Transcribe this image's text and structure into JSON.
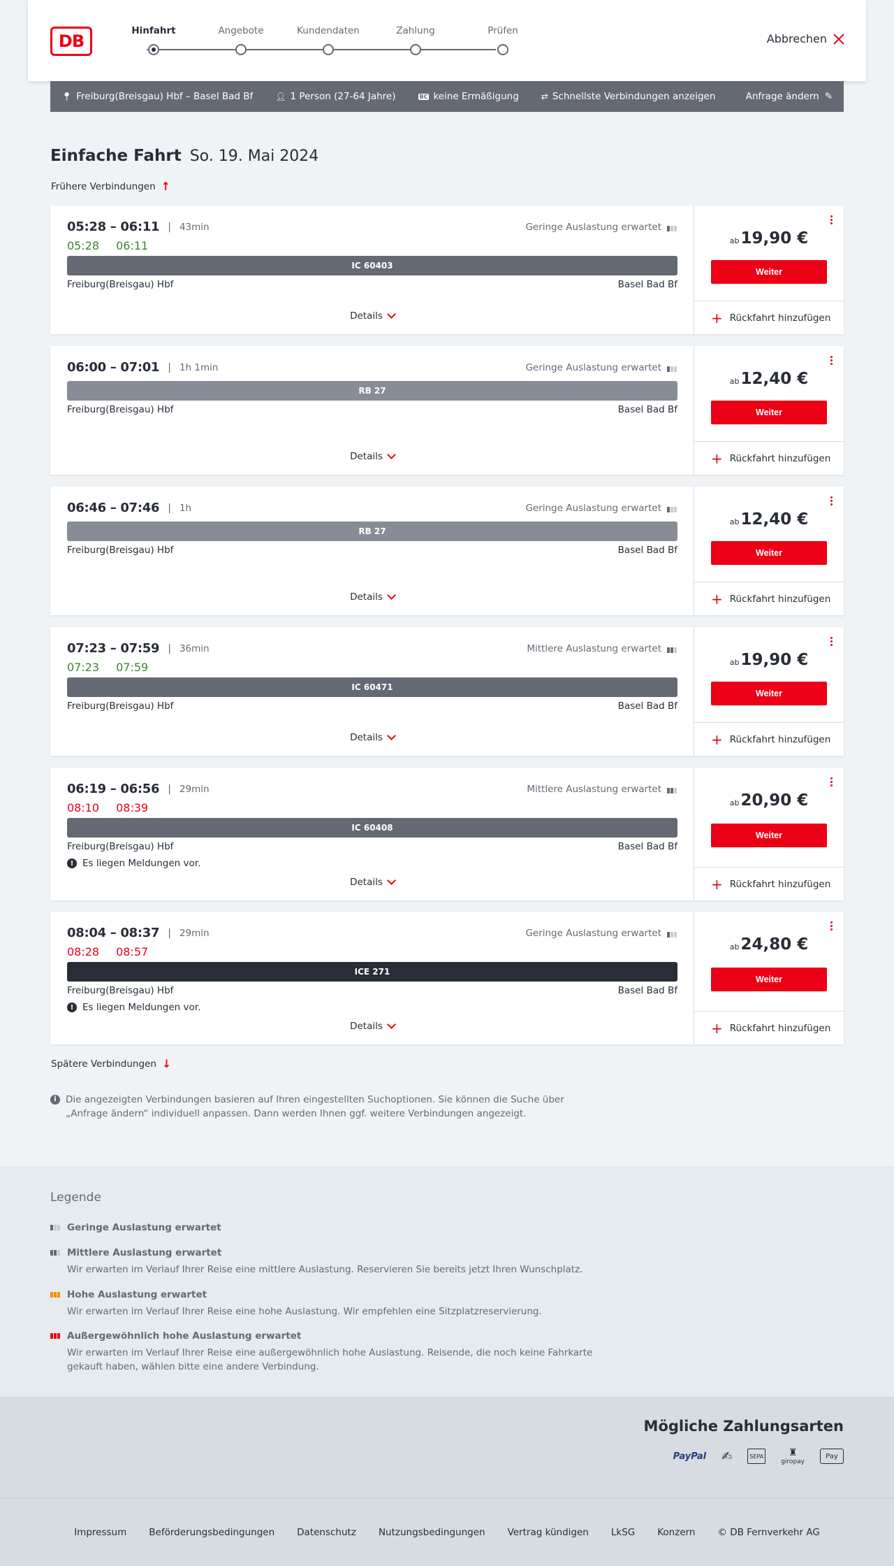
{
  "header": {
    "logo": "DB",
    "steps": [
      "Hinfahrt",
      "Angebote",
      "Kundendaten",
      "Zahlung",
      "Prüfen"
    ],
    "active_step": "Hinfahrt",
    "cancel_label": "Abbrechen"
  },
  "query": {
    "route": "Freiburg(Breisgau) Hbf – Basel Bad Bf",
    "travellers": "1 Person (27-64 Jahre)",
    "discount": "keine Ermäßigung",
    "fastest": "Schnellste Verbindungen anzeigen",
    "change": "Anfrage ändern"
  },
  "title": {
    "trip_type": "Einfache Fahrt",
    "date": "So. 19. Mai 2024"
  },
  "earlier_label": "Frühere Verbindungen",
  "later_label": "Spätere Verbindungen",
  "connections": [
    {
      "times": "05:28 – 06:11",
      "duration": "43min",
      "realtime": [
        "05:28",
        "06:11"
      ],
      "realtime_status": "green",
      "load": "Geringe Auslastung erwartet",
      "load_level": 1,
      "train": "IC 60403",
      "train_type": "ic",
      "from": "Freiburg(Breisgau) Hbf",
      "to": "Basel Bad Bf",
      "message": "",
      "price_prefix": "ab",
      "price": "19,90 €"
    },
    {
      "times": "06:00 – 07:01",
      "duration": "1h 1min",
      "realtime": [],
      "realtime_status": "",
      "load": "Geringe Auslastung erwartet",
      "load_level": 1,
      "train": "RB 27",
      "train_type": "rb",
      "from": "Freiburg(Breisgau) Hbf",
      "to": "Basel Bad Bf",
      "message": "",
      "price_prefix": "ab",
      "price": "12,40 €"
    },
    {
      "times": "06:46 – 07:46",
      "duration": "1h",
      "realtime": [],
      "realtime_status": "",
      "load": "Geringe Auslastung erwartet",
      "load_level": 1,
      "train": "RB 27",
      "train_type": "rb",
      "from": "Freiburg(Breisgau) Hbf",
      "to": "Basel Bad Bf",
      "message": "",
      "price_prefix": "ab",
      "price": "12,40 €"
    },
    {
      "times": "07:23 – 07:59",
      "duration": "36min",
      "realtime": [
        "07:23",
        "07:59"
      ],
      "realtime_status": "green",
      "load": "Mittlere Auslastung erwartet",
      "load_level": 2,
      "train": "IC 60471",
      "train_type": "ic",
      "from": "Freiburg(Breisgau) Hbf",
      "to": "Basel Bad Bf",
      "message": "",
      "price_prefix": "ab",
      "price": "19,90 €"
    },
    {
      "times": "06:19 – 06:56",
      "duration": "29min",
      "realtime": [
        "08:10",
        "08:39"
      ],
      "realtime_status": "red",
      "load": "Mittlere Auslastung erwartet",
      "load_level": 2,
      "train": "IC 60408",
      "train_type": "ic",
      "from": "Freiburg(Breisgau) Hbf",
      "to": "Basel Bad Bf",
      "message": "Es liegen Meldungen vor.",
      "price_prefix": "ab",
      "price": "20,90 €"
    },
    {
      "times": "08:04 – 08:37",
      "duration": "29min",
      "realtime": [
        "08:28",
        "08:57"
      ],
      "realtime_status": "red",
      "load": "Geringe Auslastung erwartet",
      "load_level": 1,
      "train": "ICE 271",
      "train_type": "ice",
      "from": "Freiburg(Breisgau) Hbf",
      "to": "Basel Bad Bf",
      "message": "Es liegen Meldungen vor.",
      "price_prefix": "ab",
      "price": "24,80 €"
    }
  ],
  "card_labels": {
    "details": "Details",
    "weiter": "Weiter",
    "return": "Rückfahrt hinzufügen"
  },
  "info_text": "Die angezeigten Verbindungen basieren auf Ihren eingestellten Suchoptionen. Sie können die Suche über „Anfrage ändern“ individuell anpassen. Dann werden Ihnen ggf. weitere Verbindungen angezeigt.",
  "legend": {
    "title": "Legende",
    "items": [
      {
        "label": "Geringe Auslastung erwartet",
        "desc": ""
      },
      {
        "label": "Mittlere Auslastung erwartet",
        "desc": "Wir erwarten im Verlauf Ihrer Reise eine mittlere Auslastung. Reservieren Sie bereits jetzt Ihren Wunschplatz."
      },
      {
        "label": "Hohe Auslastung erwartet",
        "desc": "Wir erwarten im Verlauf Ihrer Reise eine hohe Auslastung. Wir empfehlen eine Sitzplatzreservierung."
      },
      {
        "label": "Außergewöhnlich hohe Auslastung erwartet",
        "desc": "Wir erwarten im Verlauf Ihrer Reise eine außergewöhnlich hohe Auslastung. Reisende, die noch keine Fahrkarte gekauft haben, wählen bitte eine andere Verbindung."
      }
    ]
  },
  "payment": {
    "title": "Mögliche Zahlungsarten",
    "methods": [
      "PayPal",
      "Kreditkarte",
      "SEPA",
      "giropay",
      "Apple Pay"
    ],
    "paypal_label": "PayPal",
    "sepa_label": "SEPA",
    "giropay_label": "giropay",
    "applepay_label": "Pay"
  },
  "footer": {
    "links": [
      "Impressum",
      "Beförderungsbedingungen",
      "Datenschutz",
      "Nutzungsbedingungen",
      "Vertrag kündigen",
      "LkSG",
      "Konzern",
      "© DB Fernverkehr AG"
    ]
  },
  "colors": {
    "brand_red": "#ec0016",
    "realtime_green": "#408335",
    "dark": "#282d37",
    "grey": "#646973"
  }
}
